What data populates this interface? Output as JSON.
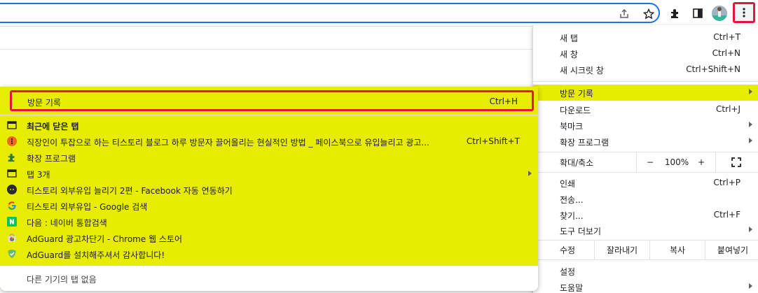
{
  "toolbar": {
    "icons": [
      "share-icon",
      "star-icon",
      "extensions-icon",
      "side-panel-icon",
      "avatar",
      "kebab-menu-icon"
    ]
  },
  "menu": {
    "new_tab": {
      "label": "새 탭",
      "shortcut": "Ctrl+T"
    },
    "new_window": {
      "label": "새 창",
      "shortcut": "Ctrl+N"
    },
    "incognito": {
      "label": "새 시크릿 창",
      "shortcut": "Ctrl+Shift+N"
    },
    "history": {
      "label": "방문 기록"
    },
    "downloads": {
      "label": "다운로드",
      "shortcut": "Ctrl+J"
    },
    "bookmarks": {
      "label": "북마크"
    },
    "extensions": {
      "label": "확장 프로그램"
    },
    "zoom": {
      "label": "확대/축소",
      "minus": "−",
      "value": "100%",
      "plus": "+"
    },
    "print": {
      "label": "인쇄",
      "shortcut": "Ctrl+P"
    },
    "cast": {
      "label": "전송..."
    },
    "find": {
      "label": "찾기...",
      "shortcut": "Ctrl+F"
    },
    "more_tools": {
      "label": "도구 더보기"
    },
    "edit": {
      "label": "수정",
      "cut": "잘라내기",
      "copy": "복사",
      "paste": "붙여넣기"
    },
    "settings": {
      "label": "설정"
    },
    "help": {
      "label": "도움말"
    }
  },
  "submenu": {
    "header": {
      "label": "방문 기록",
      "shortcut": "Ctrl+H"
    },
    "items": [
      {
        "label": "최근에 닫은 탭",
        "icon": "window-icon",
        "bold": true
      },
      {
        "label": "직장인이 투잡으로 하는 티스토리 블로그 하루 방문자 끌어올리는 현실적인 방법 _ 페이스북으로 유입늘리고 광고...",
        "shortcut": "Ctrl+Shift+T",
        "icon": "tistory-icon"
      },
      {
        "label": "확장 프로그램",
        "icon": "puzzle-icon"
      },
      {
        "label": "탭 3개",
        "icon": "window-icon",
        "submenu": true
      },
      {
        "label": "티스토리 외부유입 늘리기 2편 - Facebook 자동 연동하기",
        "icon": "tistory-dark-icon"
      },
      {
        "label": "티스토리 외부유입 - Google 검색",
        "icon": "google-icon"
      },
      {
        "label": "다음 : 네이버 통합검색",
        "icon": "naver-icon"
      },
      {
        "label": "AdGuard 광고차단기 - Chrome 웹 스토어",
        "icon": "chrome-webstore-icon"
      },
      {
        "label": "AdGuard를 설치해주셔서 감사합니다!",
        "icon": "adguard-icon"
      }
    ],
    "footer": "다른 기기의 탭 없음"
  },
  "colors": {
    "highlight": "#e8ec00",
    "red_border": "#e3143d",
    "omnibox_border": "#1a73e8"
  }
}
